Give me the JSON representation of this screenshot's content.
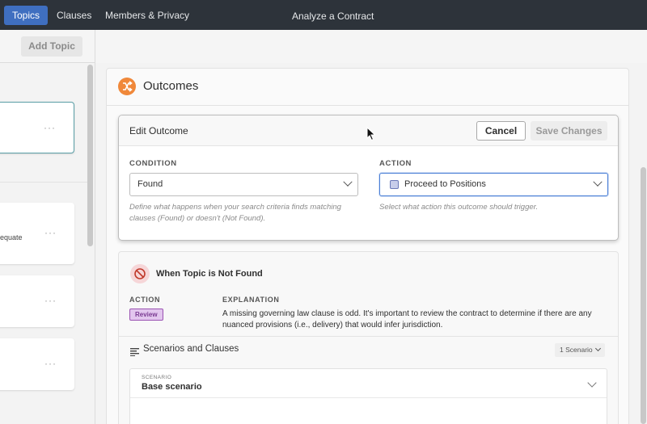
{
  "nav": {
    "tabs": [
      {
        "label": "Topics",
        "active": true
      },
      {
        "label": "Clauses",
        "active": false
      },
      {
        "label": "Members & Privacy",
        "active": false
      }
    ],
    "app_title": "Analyze a Contract"
  },
  "left_panel": {
    "add_topic_label": "Add Topic",
    "topics": [
      {
        "snippet": "",
        "selected": true,
        "menu": "···"
      },
      {
        "snippet": "equate",
        "selected": false,
        "menu": "···"
      },
      {
        "snippet": "",
        "selected": false,
        "menu": "···"
      },
      {
        "snippet": "",
        "selected": false,
        "menu": "···"
      }
    ]
  },
  "outcomes": {
    "title": "Outcomes",
    "icon": "shuffle-icon",
    "icon_color": "#f0883a"
  },
  "edit_outcome": {
    "title": "Edit Outcome",
    "cancel_label": "Cancel",
    "save_label": "Save Changes",
    "condition": {
      "label": "CONDITION",
      "value": "Found",
      "helper": "Define what happens when your search criteria finds matching clauses (Found) or doesn't (Not Found)."
    },
    "action": {
      "label": "ACTION",
      "value": "Proceed to Positions",
      "swatch_color": "#c7cdea",
      "helper": "Select what action this outcome should trigger."
    }
  },
  "not_found": {
    "title": "When Topic is Not Found",
    "icon": "prohibited-icon",
    "action_label": "ACTION",
    "action_badge": "Review",
    "badge_color": "#e2c6ee",
    "explanation_label": "EXPLANATION",
    "explanation": "A missing governing law clause is odd. It's important to review the contract to determine if there are any nuanced provisions (i.e., delivery) that would infer jurisdiction.",
    "scenarios_title": "Scenarios and Clauses",
    "scenario_count": "1 Scenario",
    "scenario": {
      "small_label": "SCENARIO",
      "name": "Base scenario"
    }
  }
}
